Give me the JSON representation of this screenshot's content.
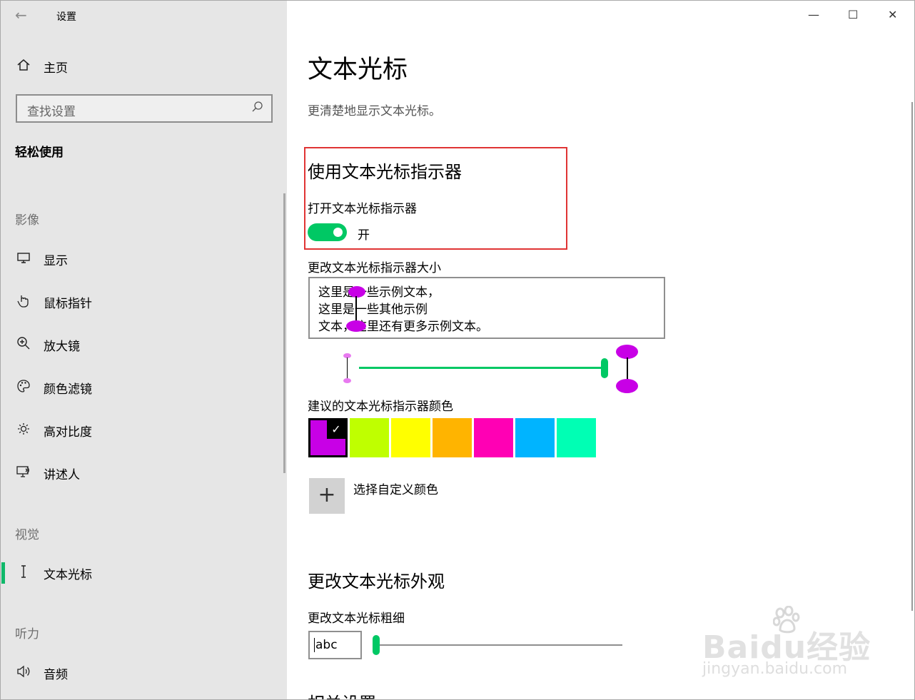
{
  "window": {
    "title": "设置",
    "back_icon": "←",
    "minimize_icon": "—",
    "maximize_icon": "☐",
    "close_icon": "✕"
  },
  "sidebar": {
    "home_label": "主页",
    "search_placeholder": "查找设置",
    "group_title": "轻松使用",
    "sections": {
      "vision": "影像",
      "visual": "视觉",
      "hearing": "听力"
    },
    "items": [
      {
        "label": "显示",
        "icon": "display-icon"
      },
      {
        "label": "鼠标指针",
        "icon": "mouse-pointer-icon"
      },
      {
        "label": "放大镜",
        "icon": "magnifier-icon"
      },
      {
        "label": "颜色滤镜",
        "icon": "color-filter-icon"
      },
      {
        "label": "高对比度",
        "icon": "brightness-icon"
      },
      {
        "label": "讲述人",
        "icon": "narrator-icon"
      },
      {
        "label": "文本光标",
        "icon": "text-cursor-icon",
        "active": true
      },
      {
        "label": "音频",
        "icon": "speaker-icon"
      }
    ]
  },
  "main": {
    "title": "文本光标",
    "description": "更清楚地显示文本光标。",
    "indicator_section_title": "使用文本光标指示器",
    "toggle_label": "打开文本光标指示器",
    "toggle_state_text": "开",
    "toggle_on": true,
    "size_label": "更改文本光标指示器大小",
    "sample_lines": [
      "这里是一些示例文本，",
      "这里是一些其他示例",
      "文本，这里还有更多示例文本。"
    ],
    "size_value_fraction": 1.0,
    "color_label": "建议的文本光标指示器颜色",
    "colors": [
      "#c800e6",
      "#bfff00",
      "#ffff00",
      "#ffb400",
      "#ff00b4",
      "#00b4ff",
      "#00ffb4"
    ],
    "selected_color_index": 0,
    "custom_color_label": "选择自定义颜色",
    "appearance_title": "更改文本光标外观",
    "thickness_label": "更改文本光标粗细",
    "thickness_preview": "abc",
    "thickness_value_fraction": 0.0,
    "accent_color": "#00c864",
    "highlight_box_color": "#e03434",
    "related_title": "相关设置"
  },
  "watermark": {
    "text": "Baidu经验",
    "url_text": "jingyan.baidu.com"
  }
}
